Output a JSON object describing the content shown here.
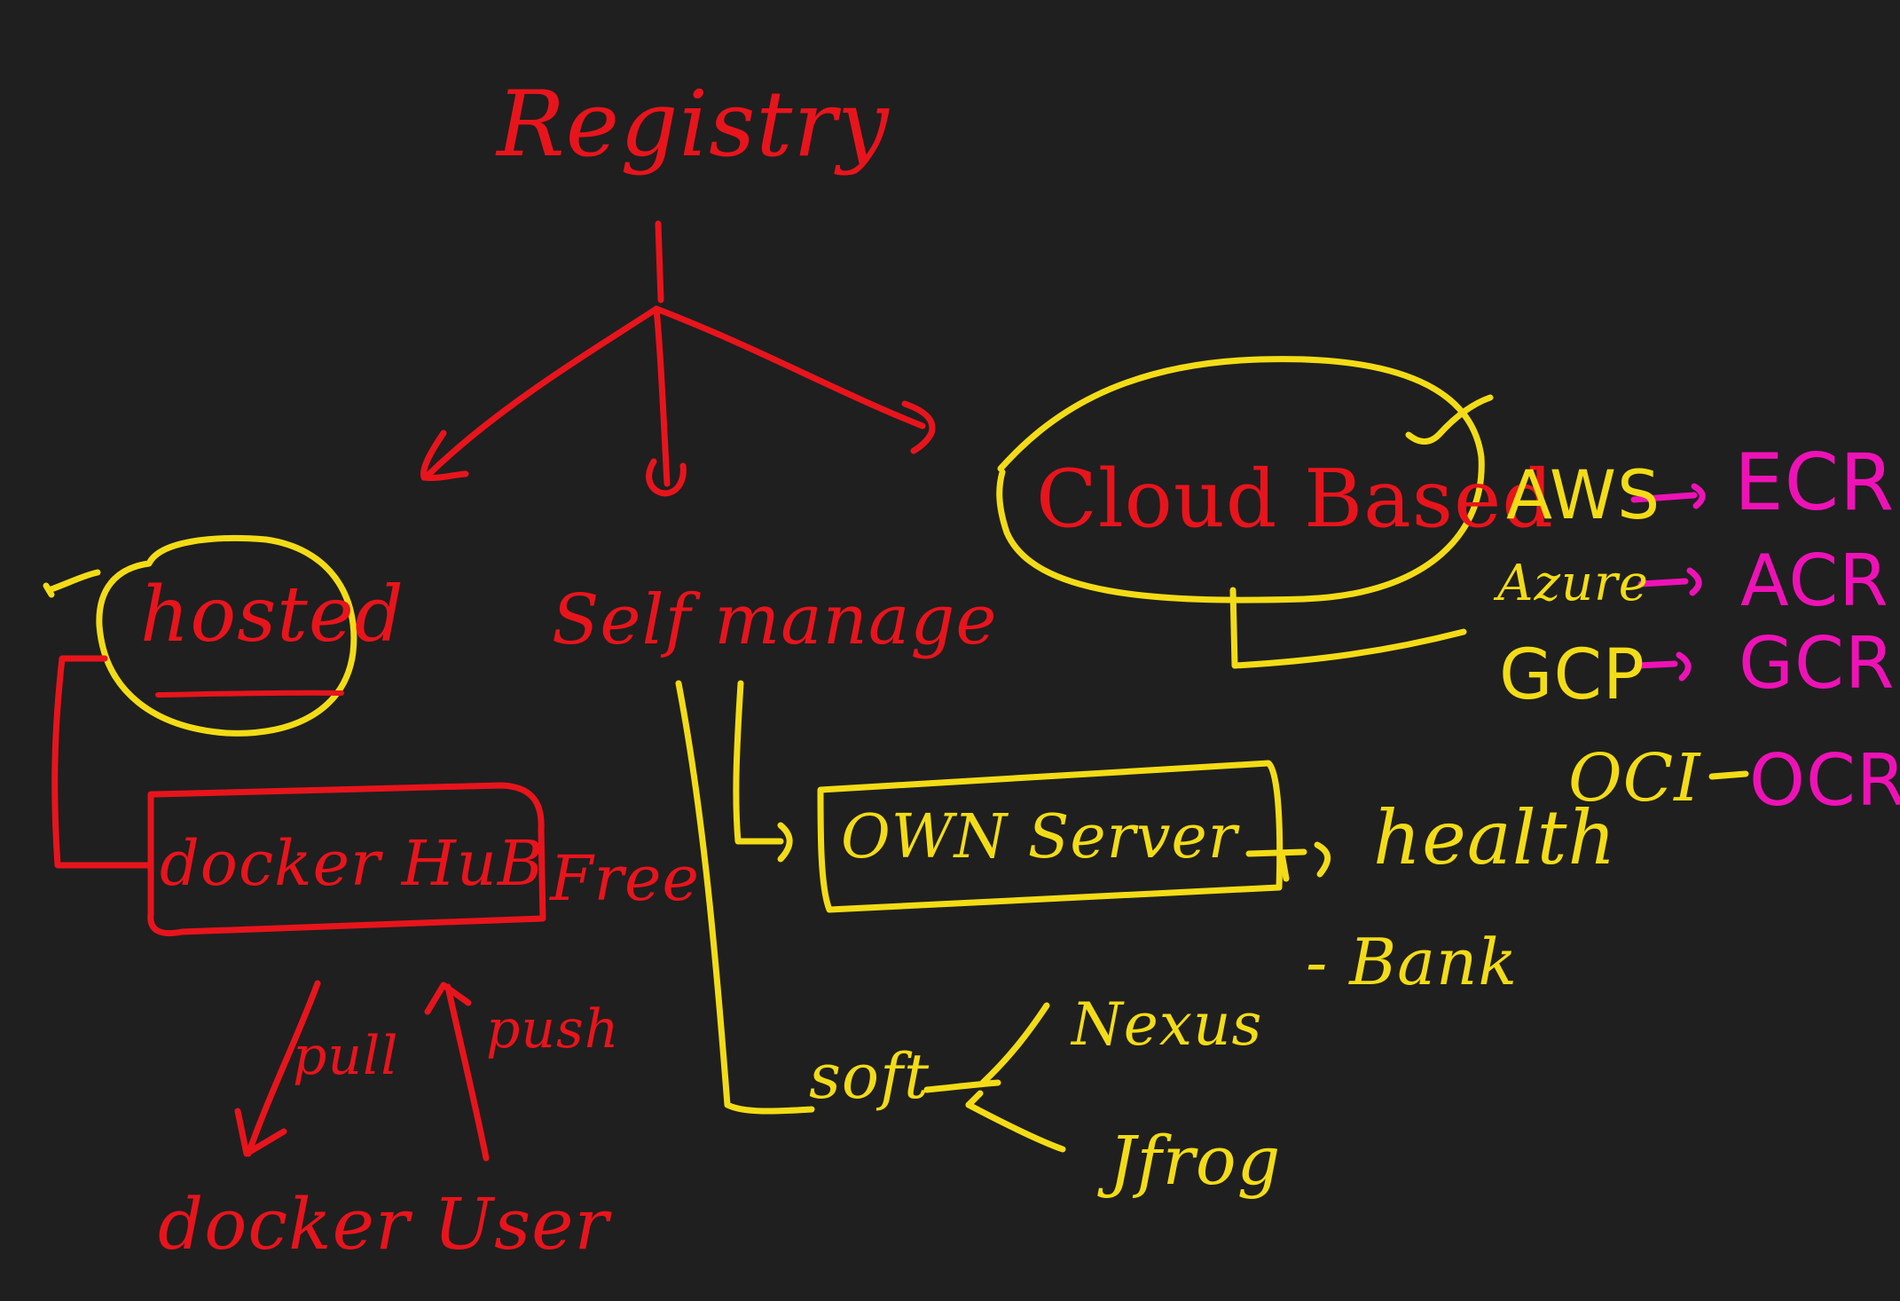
{
  "colors": {
    "background": "#1f1f1f",
    "red": "#e8141c",
    "yellow": "#f3dc16",
    "magenta": "#ee12b6"
  },
  "labels": {
    "title": "Registry",
    "hosted": "hosted",
    "self_manage": "Self manage",
    "cloud_based": "Cloud Based",
    "docker_hub": "docker HuB",
    "free": "Free",
    "pull": "pull",
    "push": "push",
    "docker_user": "docker User",
    "own_server": "OWN Server",
    "health": "health",
    "bank": "- Bank",
    "soft": "soft",
    "nexus": "Nexus",
    "jfrog": "Jfrog",
    "aws": "AWS",
    "azure": "Azure",
    "gcp": "GCP",
    "oci": "OCI",
    "ecr": "ECR",
    "acr": "ACR",
    "gcr": "GCR",
    "ocr": "OCR"
  }
}
